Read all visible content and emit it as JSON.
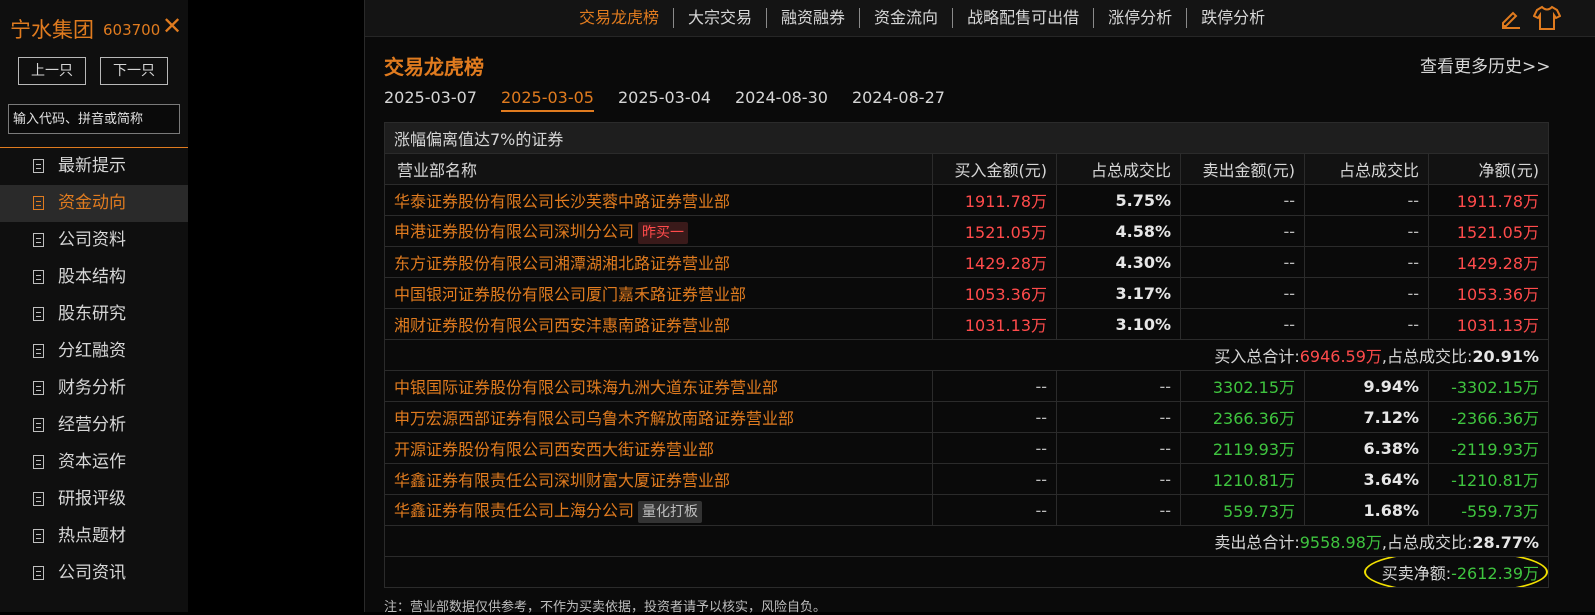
{
  "stock": {
    "name": "宁水集团",
    "code": "603700"
  },
  "sidebar": {
    "prev_label": "上一只",
    "next_label": "下一只",
    "search_placeholder": "输入代码、拼音或简称",
    "items": [
      {
        "label": "最新提示"
      },
      {
        "label": "资金动向"
      },
      {
        "label": "公司资料"
      },
      {
        "label": "股本结构"
      },
      {
        "label": "股东研究"
      },
      {
        "label": "分红融资"
      },
      {
        "label": "财务分析"
      },
      {
        "label": "经营分析"
      },
      {
        "label": "资本运作"
      },
      {
        "label": "研报评级"
      },
      {
        "label": "热点题材"
      },
      {
        "label": "公司资讯"
      }
    ],
    "active_index": 1
  },
  "topnav": {
    "tabs": [
      "交易龙虎榜",
      "大宗交易",
      "融资融券",
      "资金流向",
      "战略配售可出借",
      "涨停分析",
      "跌停分析"
    ],
    "active_index": 0
  },
  "section": {
    "title": "交易龙虎榜",
    "more_link": "查看更多历史>>"
  },
  "dates": {
    "items": [
      "2025-03-07",
      "2025-03-05",
      "2025-03-04",
      "2024-08-30",
      "2024-08-27"
    ],
    "active_index": 1
  },
  "table": {
    "caption": "涨幅偏离值达7%的证券",
    "headers": [
      "营业部名称",
      "买入金额(元)",
      "占总成交比",
      "卖出金额(元)",
      "占总成交比",
      "净额(元)"
    ],
    "buy_rows": [
      {
        "name": "华泰证券股份有限公司长沙芙蓉中路证券营业部",
        "tag": "",
        "buy": "1911.78万",
        "buy_pct": "5.75%",
        "sell": "--",
        "sell_pct": "--",
        "net": "1911.78万"
      },
      {
        "name": "申港证券股份有限公司深圳分公司",
        "tag": "昨买一",
        "buy": "1521.05万",
        "buy_pct": "4.58%",
        "sell": "--",
        "sell_pct": "--",
        "net": "1521.05万"
      },
      {
        "name": "东方证券股份有限公司湘潭湖湘北路证券营业部",
        "tag": "",
        "buy": "1429.28万",
        "buy_pct": "4.30%",
        "sell": "--",
        "sell_pct": "--",
        "net": "1429.28万"
      },
      {
        "name": "中国银河证券股份有限公司厦门嘉禾路证券营业部",
        "tag": "",
        "buy": "1053.36万",
        "buy_pct": "3.17%",
        "sell": "--",
        "sell_pct": "--",
        "net": "1053.36万"
      },
      {
        "name": "湘财证券股份有限公司西安沣惠南路证券营业部",
        "tag": "",
        "buy": "1031.13万",
        "buy_pct": "3.10%",
        "sell": "--",
        "sell_pct": "--",
        "net": "1031.13万"
      }
    ],
    "buy_total": {
      "label": "买入总合计:",
      "amount": "6946.59万",
      "pct_label": ",占总成交比:",
      "pct": "20.91%"
    },
    "sell_rows": [
      {
        "name": "中银国际证券股份有限公司珠海九洲大道东证券营业部",
        "tag": "",
        "buy": "--",
        "buy_pct": "--",
        "sell": "3302.15万",
        "sell_pct": "9.94%",
        "net": "-3302.15万"
      },
      {
        "name": "申万宏源西部证券有限公司乌鲁木齐解放南路证券营业部",
        "tag": "",
        "buy": "--",
        "buy_pct": "--",
        "sell": "2366.36万",
        "sell_pct": "7.12%",
        "net": "-2366.36万"
      },
      {
        "name": "开源证券股份有限公司西安西大街证券营业部",
        "tag": "",
        "buy": "--",
        "buy_pct": "--",
        "sell": "2119.93万",
        "sell_pct": "6.38%",
        "net": "-2119.93万"
      },
      {
        "name": "华鑫证券有限责任公司深圳财富大厦证券营业部",
        "tag": "",
        "buy": "--",
        "buy_pct": "--",
        "sell": "1210.81万",
        "sell_pct": "3.64%",
        "net": "-1210.81万"
      },
      {
        "name": "华鑫证券有限责任公司上海分公司",
        "tag": "量化打板",
        "buy": "--",
        "buy_pct": "--",
        "sell": "559.73万",
        "sell_pct": "1.68%",
        "net": "-559.73万"
      }
    ],
    "sell_total": {
      "label": "卖出总合计:",
      "amount": "9558.98万",
      "pct_label": ",占总成交比:",
      "pct": "28.77%"
    },
    "net": {
      "label": "买卖净额:",
      "value": "-2612.39万"
    }
  },
  "footnote": "注：营业部数据仅供参考，不作为买卖依据，投资者请予以核实，风险自负。",
  "colors": {
    "accent": "#e07b1f",
    "up": "#ff4b4b",
    "down": "#3fc43f",
    "highlight": "#f2e000"
  }
}
